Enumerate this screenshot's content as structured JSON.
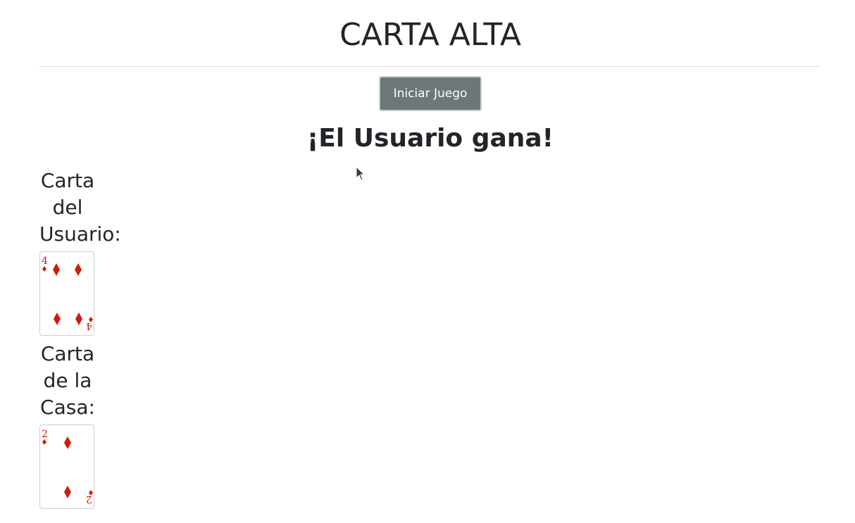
{
  "header": {
    "title": "CARTA ALTA"
  },
  "controls": {
    "start_label": "Iniciar Juego"
  },
  "game": {
    "result": "¡El Usuario gana!"
  },
  "user": {
    "label_lines": [
      "Carta",
      "del",
      "Usuario:"
    ],
    "card": {
      "rank": "4",
      "suit": "diamonds",
      "icon": "diamond-icon"
    }
  },
  "house": {
    "label_lines": [
      "Carta",
      "de la",
      "Casa:"
    ],
    "card": {
      "rank": "2",
      "suit": "diamonds",
      "icon": "diamond-icon"
    }
  },
  "colors": {
    "card_red": "#cc1d0b",
    "button_bg": "#6c7778",
    "text": "#212529"
  }
}
